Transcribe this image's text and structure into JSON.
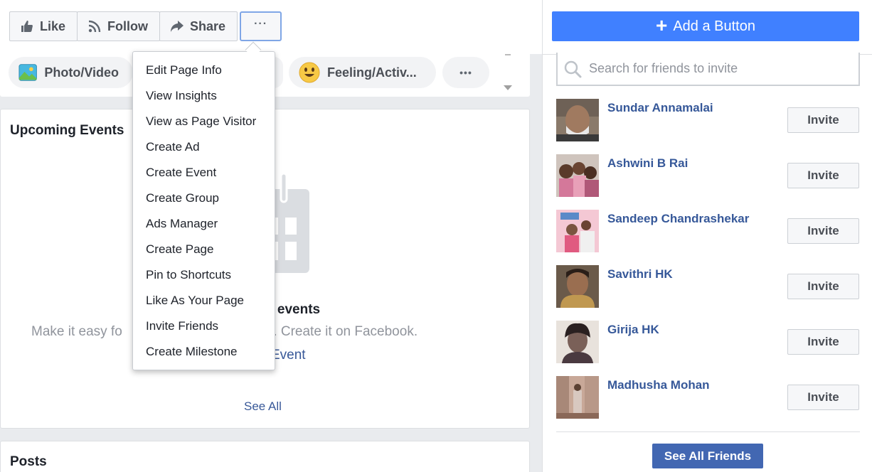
{
  "action_bar": {
    "like_label": "Like",
    "follow_label": "Follow",
    "share_label": "Share",
    "more_label": "···"
  },
  "composer": {
    "photo_label": "Photo/Video",
    "feeling_label": "Feeling/Activ...",
    "more_label": "•••"
  },
  "events": {
    "title": "Upcoming Events",
    "empty_title": "g events",
    "empty_desc": "Make it easy fo",
    "empty_desc_tail": "xt event. Create it on Facebook.",
    "link_label": "Event",
    "see_all": "See All"
  },
  "posts": {
    "title": "Posts"
  },
  "add_button": {
    "label": "Add a Button"
  },
  "search": {
    "placeholder": "Search for friends to invite"
  },
  "friends": [
    {
      "name": "Sundar Annamalai",
      "invite_label": "Invite"
    },
    {
      "name": "Ashwini B Rai",
      "invite_label": "Invite"
    },
    {
      "name": "Sandeep Chandrashekar",
      "invite_label": "Invite"
    },
    {
      "name": "Savithri HK",
      "invite_label": "Invite"
    },
    {
      "name": "Girija HK",
      "invite_label": "Invite"
    },
    {
      "name": "Madhusha Mohan",
      "invite_label": "Invite"
    }
  ],
  "see_all_friends": "See All Friends",
  "menu": {
    "items": [
      "Edit Page Info",
      "View Insights",
      "View as Page Visitor",
      "Create Ad",
      "Create Event",
      "Create Group",
      "Ads Manager",
      "Create Page",
      "Pin to Shortcuts",
      "Like As Your Page",
      "Invite Friends",
      "Create Milestone"
    ]
  },
  "colors": {
    "accent": "#4080ff",
    "link": "#385898",
    "button_dark": "#4267b2"
  }
}
